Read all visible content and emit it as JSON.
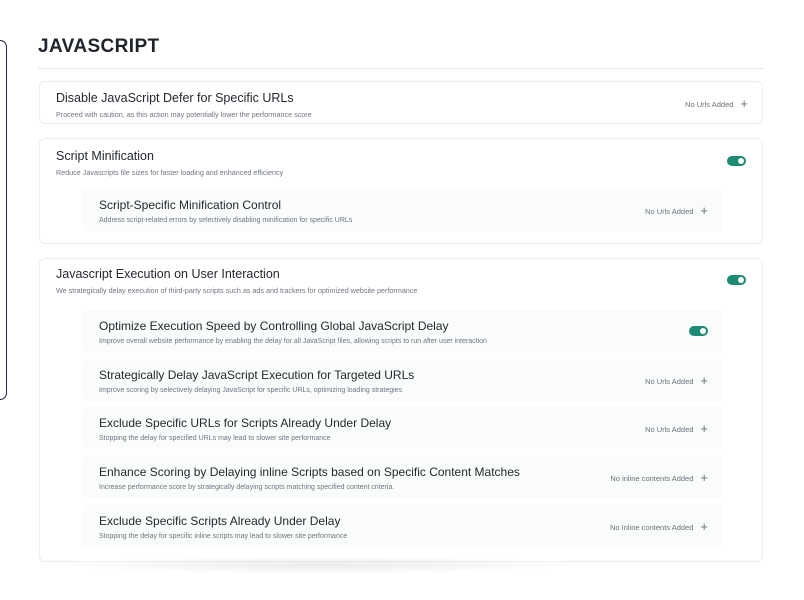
{
  "page": {
    "title": "JAVASCRIPT"
  },
  "colors": {
    "accent": "#1d8a74",
    "rail": "#2a1c46"
  },
  "defer": {
    "title": "Disable JavaScript Defer for Specific URLs",
    "desc": "Proceed with caution, as this action may potentially lower the performance score",
    "action": "No Urls Added"
  },
  "minification": {
    "title": "Script Minification",
    "desc": "Reduce Javascripts file sizes for faster loading and enhanced efficiency",
    "enabled": true,
    "control": {
      "title": "Script-Specific Minification Control",
      "desc": "Address script-related errors by selectively disabling minification for specific URLs",
      "action": "No Urls Added"
    }
  },
  "execution": {
    "title": "Javascript Execution on User Interaction",
    "desc": "We strategically delay execution of third-party scripts such as ads and trackers for optimized website performance",
    "enabled": true,
    "items": [
      {
        "title": "Optimize Execution Speed by Controlling Global JavaScript Delay",
        "desc": "Improve overall website performance by enabling the delay for all JavaScript files, allowing scripts to run after user interaction",
        "enabled": true
      },
      {
        "title": "Strategically Delay JavaScript Execution for Targeted URLs",
        "desc": "Improve scoring by selectively delaying JavaScript for specific URLs, optimizing loading strategies",
        "action": "No Urls Added"
      },
      {
        "title": "Exclude Specific URLs for Scripts Already Under Delay",
        "desc": "Stopping the delay for specified URLs may lead to slower site performance",
        "action": "No Urls Added"
      },
      {
        "title": "Enhance Scoring by Delaying inline Scripts based on Specific Content Matches",
        "desc": "Increase performance score by strategically delaying scripts matching specified content criteria.",
        "action": "No inline contents Added"
      },
      {
        "title": "Exclude Specific Scripts Already Under Delay",
        "desc": "Stopping the delay for specific inline scripts may lead to slower site performance",
        "action": "No Inline contents Added"
      }
    ]
  },
  "icons": {
    "add": "plus-icon"
  }
}
